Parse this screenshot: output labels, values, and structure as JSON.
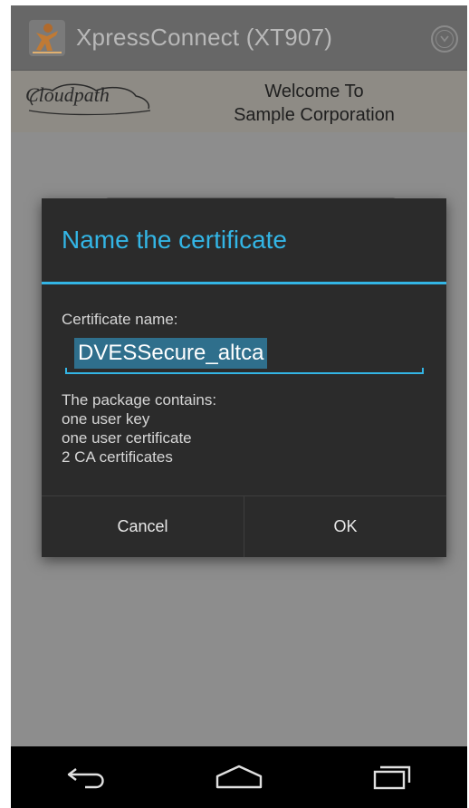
{
  "appbar": {
    "title": "XpressConnect  (XT907)",
    "app_icon": "xpressconnect-app-icon",
    "overflow_icon": "overflow-menu-icon"
  },
  "banner": {
    "logo_text": "Cloudpath",
    "welcome_line1": "Welcome To",
    "welcome_line2": "Sample Corporation"
  },
  "dialog": {
    "title": "Name the certificate",
    "cert_label": "Certificate name:",
    "cert_value": "DVESSecure_altca",
    "package_heading": "The package contains:",
    "package_items": [
      "one user key",
      "one user certificate",
      "2 CA certificates"
    ],
    "cancel_label": "Cancel",
    "ok_label": "OK"
  },
  "navbar": {
    "back_icon": "back-icon",
    "home_icon": "home-icon",
    "recents_icon": "recent-apps-icon"
  },
  "colors": {
    "accent": "#33b5e5",
    "dialog_bg": "#2b2b2b",
    "selection": "#2f6f8c"
  }
}
